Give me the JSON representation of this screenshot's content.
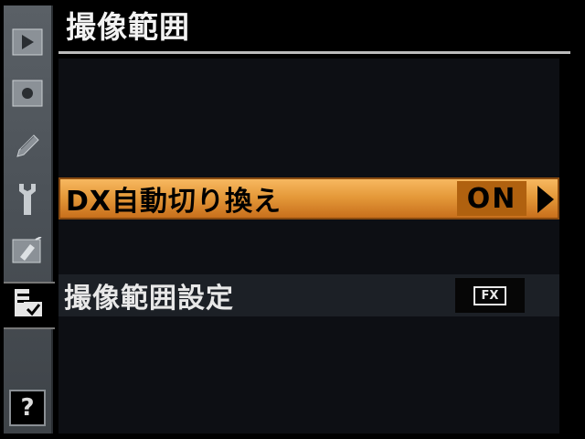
{
  "header": {
    "title": "撮像範囲"
  },
  "sidebar": {
    "items": [
      {
        "icon": "playback-icon"
      },
      {
        "icon": "camera-icon"
      },
      {
        "icon": "pencil-icon"
      },
      {
        "icon": "wrench-icon"
      },
      {
        "icon": "retouch-icon"
      },
      {
        "icon": "my-menu-icon",
        "active": true
      }
    ],
    "help_label": "?"
  },
  "menu": {
    "rows": [
      {
        "label": "DX自動切り換え",
        "value": "ON",
        "selected": true
      },
      {
        "label": "撮像範囲設定",
        "value": "FX"
      }
    ]
  },
  "colors": {
    "accent": "#e59a3a",
    "background": "#000000",
    "sidebar": "#4a5056"
  }
}
